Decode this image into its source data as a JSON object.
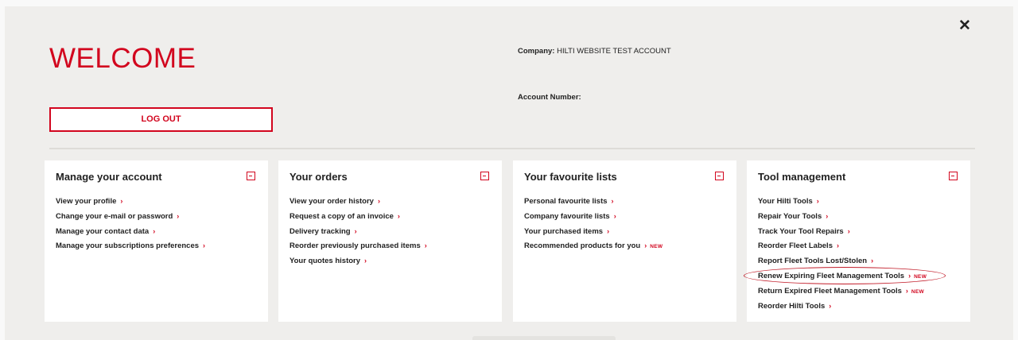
{
  "header": {
    "welcome": "WELCOME",
    "logout_label": "LOG OUT",
    "close_glyph": "✕",
    "company_label": "Company:",
    "company_value": "HILTI WEBSITE TEST ACCOUNT",
    "account_number_label": "Account Number:",
    "account_number_value": ""
  },
  "icons": {
    "chevron": "›",
    "close": "close-icon",
    "collapse": "collapse-icon"
  },
  "colors": {
    "accent": "#d2051e",
    "panel_bg": "#efeeec",
    "card_bg": "#ffffff"
  },
  "cards": [
    {
      "title": "Manage your account",
      "links": [
        {
          "label": "View your profile",
          "new": ""
        },
        {
          "label": "Change your e-mail or password",
          "new": ""
        },
        {
          "label": "Manage your contact data",
          "new": ""
        },
        {
          "label": "Manage your subscriptions preferences",
          "new": ""
        }
      ]
    },
    {
      "title": "Your orders",
      "links": [
        {
          "label": "View your order history",
          "new": ""
        },
        {
          "label": "Request a copy of an invoice",
          "new": ""
        },
        {
          "label": "Delivery tracking",
          "new": ""
        },
        {
          "label": "Reorder previously purchased items",
          "new": ""
        },
        {
          "label": "Your quotes history",
          "new": ""
        }
      ]
    },
    {
      "title": "Your favourite lists",
      "links": [
        {
          "label": "Personal favourite lists",
          "new": ""
        },
        {
          "label": "Company favourite lists",
          "new": ""
        },
        {
          "label": "Your purchased items",
          "new": ""
        },
        {
          "label": "Recommended products for you",
          "new": "NEW"
        }
      ]
    },
    {
      "title": "Tool management",
      "links": [
        {
          "label": "Your Hilti Tools",
          "new": ""
        },
        {
          "label": "Repair Your Tools",
          "new": ""
        },
        {
          "label": "Track Your Tool Repairs",
          "new": ""
        },
        {
          "label": "Reorder Fleet Labels",
          "new": ""
        },
        {
          "label": "Report Fleet Tools Lost/Stolen",
          "new": ""
        },
        {
          "label": "Renew Expiring Fleet Management Tools",
          "new": "NEW",
          "highlighted": true
        },
        {
          "label": "Return Expired Fleet Management Tools",
          "new": "NEW"
        },
        {
          "label": "Reorder Hilti Tools",
          "new": ""
        }
      ]
    }
  ]
}
